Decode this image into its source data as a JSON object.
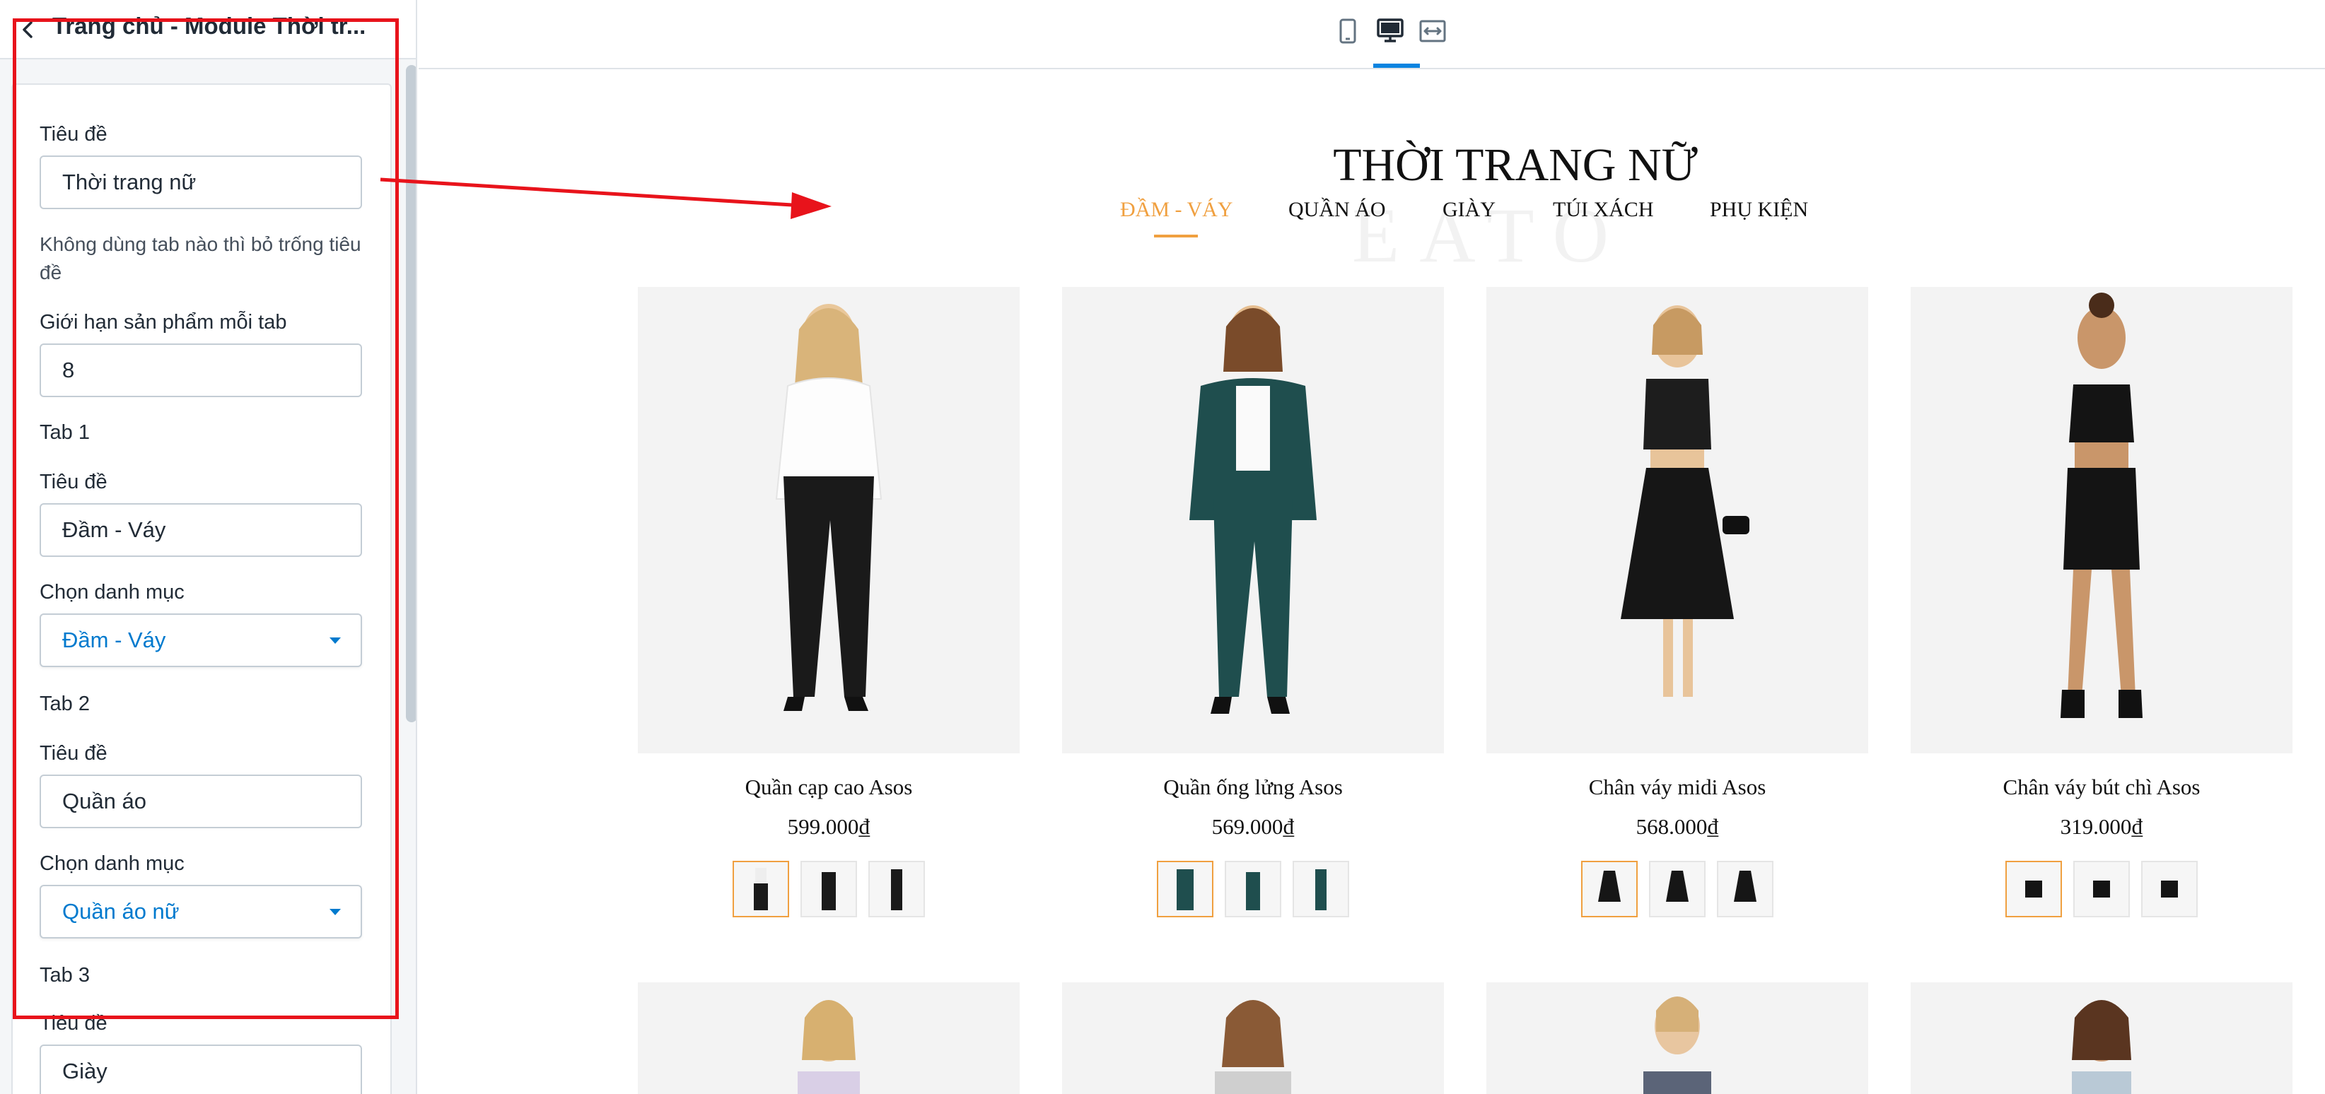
{
  "sidebar": {
    "title": "Trang chủ - Module Thời tr...",
    "fields": {
      "heading_label": "Tiêu đề",
      "heading_value": "Thời trang nữ",
      "heading_help": "Không dùng tab nào thì bỏ trống tiêu đề",
      "limit_label": "Giới hạn sản phẩm mỗi tab",
      "limit_value": "8"
    },
    "tabs": [
      {
        "section": "Tab 1",
        "title_label": "Tiêu đề",
        "title_value": "Đầm - Váy",
        "category_label": "Chọn danh mục",
        "category_value": "Đầm - Váy"
      },
      {
        "section": "Tab 2",
        "title_label": "Tiêu đề",
        "title_value": "Quần áo",
        "category_label": "Chọn danh mục",
        "category_value": "Quần áo nữ"
      },
      {
        "section": "Tab 3",
        "title_label": "Tiêu đề",
        "title_value": "Giày"
      }
    ]
  },
  "toolbar": {
    "icons": [
      "mobile-view-icon",
      "desktop-view-icon",
      "full-width-view-icon"
    ],
    "active": "desktop-view-icon"
  },
  "preview": {
    "section_title": "THỜI TRANG NỮ",
    "watermark": "EATO",
    "tabs": [
      "ĐẦM - VÁY",
      "QUẦN ÁO",
      "GIÀY",
      "TÚI XÁCH",
      "PHỤ KIỆN"
    ],
    "active_tab": "ĐẦM - VÁY",
    "products": [
      {
        "name": "Quần cạp cao Asos",
        "price": "599.000₫"
      },
      {
        "name": "Quần ống lửng Asos",
        "price": "569.000₫"
      },
      {
        "name": "Chân váy midi Asos",
        "price": "568.000₫"
      },
      {
        "name": "Chân váy bút chì Asos",
        "price": "319.000₫"
      }
    ]
  },
  "colors": {
    "accent": "#f0a040",
    "link_blue": "#007ace",
    "highlight_red": "#e8131b",
    "active_indicator": "#0a84e0"
  }
}
